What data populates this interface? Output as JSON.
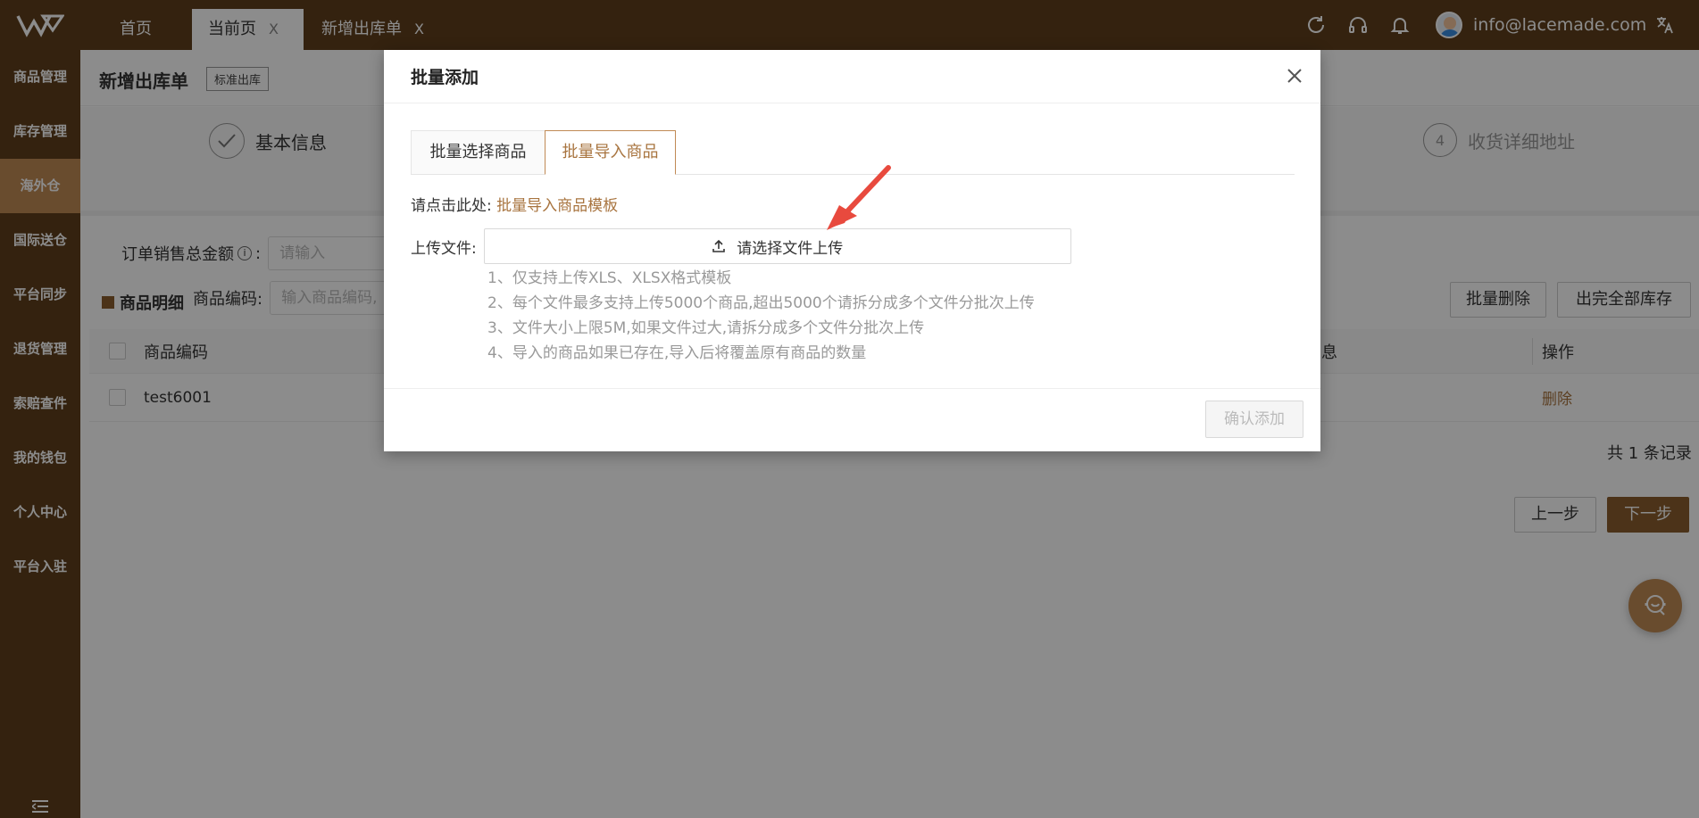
{
  "header": {
    "tabs": [
      {
        "label": "首页"
      },
      {
        "label": "当前页",
        "close": "X"
      },
      {
        "label": "新增出库单",
        "close": "X"
      }
    ],
    "user_email": "info@lacemade.com",
    "icons": [
      "refresh-icon",
      "headset-icon",
      "bell-icon",
      "translate-icon"
    ]
  },
  "sidebar": {
    "items": [
      {
        "label": "商品管理"
      },
      {
        "label": "库存管理"
      },
      {
        "label": "海外仓",
        "active": true
      },
      {
        "label": "国际送仓"
      },
      {
        "label": "平台同步"
      },
      {
        "label": "退货管理"
      },
      {
        "label": "索赔查件"
      },
      {
        "label": "我的钱包"
      },
      {
        "label": "个人中心"
      },
      {
        "label": "平台入驻"
      }
    ]
  },
  "page": {
    "title": "新增出库单",
    "badge": "标准出库",
    "steps": [
      {
        "label": "基本信息"
      },
      {
        "num": "4",
        "label": "收货详细地址"
      }
    ],
    "form": {
      "order_amount_label": "订单销售总金额",
      "order_amount_placeholder": "请输入",
      "info_icon": "i",
      "colon": ":",
      "sku_label": "商品编码:",
      "sku_placeholder": "输入商品编码,"
    },
    "section_title": "商品明细",
    "buttons": {
      "batch_delete": "批量删除",
      "clear_stock": "出完全部库存",
      "prev": "上一步",
      "next": "下一步"
    },
    "table": {
      "columns": [
        "商品编码",
        "息",
        "操作"
      ],
      "rows": [
        {
          "sku": "test6001",
          "action": "删除"
        }
      ]
    },
    "total": "共 1 条记录"
  },
  "modal": {
    "title": "批量添加",
    "tabs": [
      "批量选择商品",
      "批量导入商品"
    ],
    "active_tab": 1,
    "hint_prefix": "请点击此处:",
    "template_link": "批量导入商品模板",
    "upload_label": "上传文件:",
    "upload_button": "请选择文件上传",
    "notes": [
      "1、仅支持上传XLS、XLSX格式模板",
      "2、每个文件最多支持上传5000个商品,超出5000个请拆分成多个文件分批次上传",
      "3、文件大小上限5M,如果文件过大,请拆分成多个文件分批次上传",
      "4、导入的商品如果已存在,导入后将覆盖原有商品的数量"
    ],
    "confirm_button": "确认添加"
  },
  "colors": {
    "brand_dark": "#5f3f1c",
    "brand_accent": "#c08a55",
    "link": "#a8743f",
    "annotation_arrow": "#e84a3e"
  }
}
